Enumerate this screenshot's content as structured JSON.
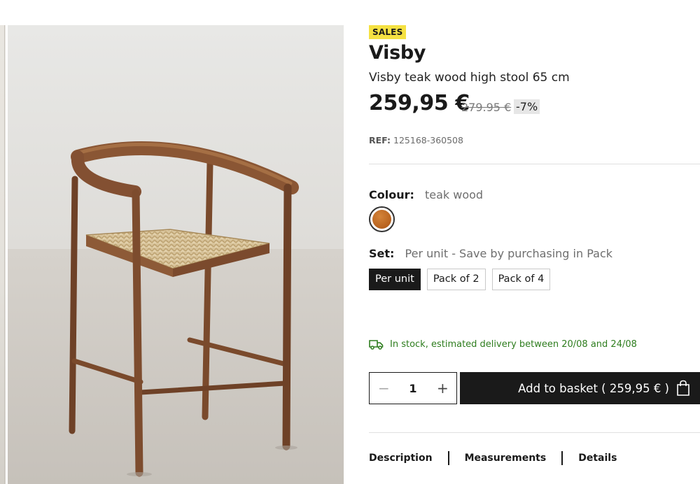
{
  "product": {
    "badge": "SALES",
    "title": "Visby",
    "subtitle": "Visby teak wood high stool 65 cm",
    "price_current": "259,95 €",
    "price_old": "279.95 €",
    "discount": "-7%",
    "ref_label": "REF:",
    "ref_value": "125168-360508"
  },
  "colour": {
    "label": "Colour:",
    "value": "teak wood",
    "swatch_color": "#b8621e"
  },
  "set": {
    "label": "Set:",
    "value": "Per unit - Save by purchasing in Pack",
    "options": [
      "Per unit",
      "Pack of 2",
      "Pack of 4"
    ],
    "selected": "Per unit"
  },
  "stock": {
    "text": "In stock, estimated delivery between 20/08 and 24/08",
    "icon": "truck-icon",
    "color": "#2e7d1e"
  },
  "purchase": {
    "quantity": "1",
    "minus_symbol": "−",
    "plus_symbol": "+",
    "add_label": "Add to basket ( 259,95 € )",
    "basket_icon": "shopping-bag-icon"
  },
  "tabs": [
    "Description",
    "Measurements",
    "Details"
  ],
  "colors": {
    "badge_bg": "#f5e142",
    "primary": "#1a1a1a",
    "stock_green": "#2e7d1e"
  }
}
